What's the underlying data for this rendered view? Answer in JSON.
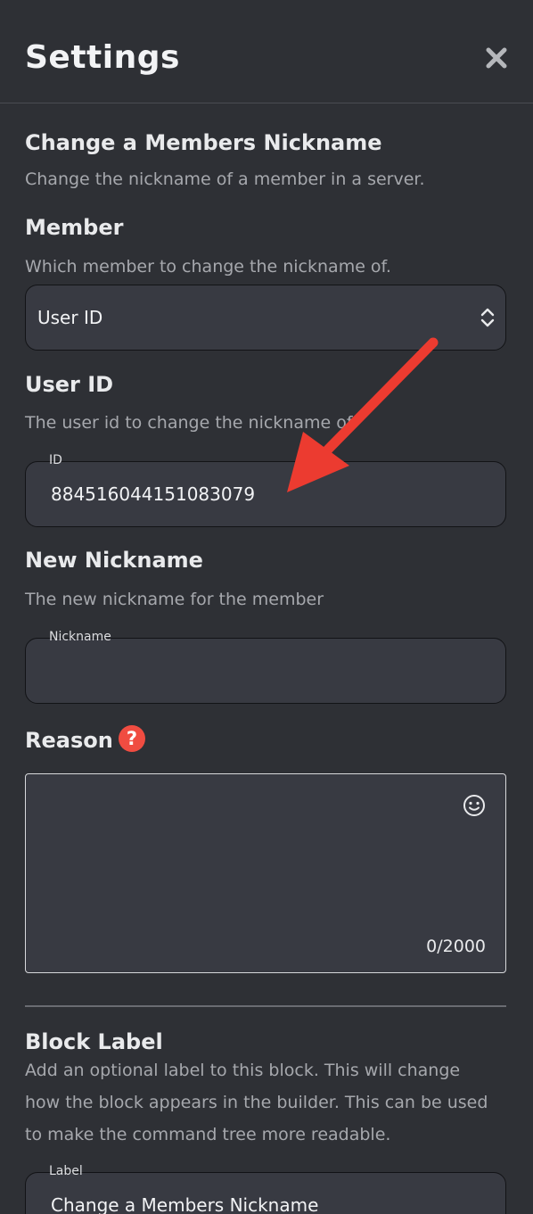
{
  "header": {
    "title": "Settings",
    "close_icon": "close-icon"
  },
  "block": {
    "title": "Change a Members Nickname",
    "description": "Change the nickname of a member in a server."
  },
  "member": {
    "heading": "Member",
    "description": "Which member to change the nickname of.",
    "selected": "User ID"
  },
  "user_id": {
    "heading": "User ID",
    "description": "The user id to change the nickname of.",
    "field_label": "ID",
    "value": "884516044151083079"
  },
  "new_nickname": {
    "heading": "New Nickname",
    "description": "The new nickname for the member",
    "field_label": "Nickname",
    "value": ""
  },
  "reason": {
    "heading": "Reason",
    "help_icon": "?",
    "counter": "0/2000",
    "value": ""
  },
  "block_label": {
    "heading": "Block Label",
    "description_lines": [
      "Add an optional label to this block. This will change",
      "how the block appears in the builder. This can be used",
      "to make the command tree more readable."
    ],
    "field_label": "Label",
    "value": "Change a Members Nickname"
  },
  "colors": {
    "background": "#2e3035",
    "field": "#383a42",
    "accent_red": "#f04c41"
  }
}
